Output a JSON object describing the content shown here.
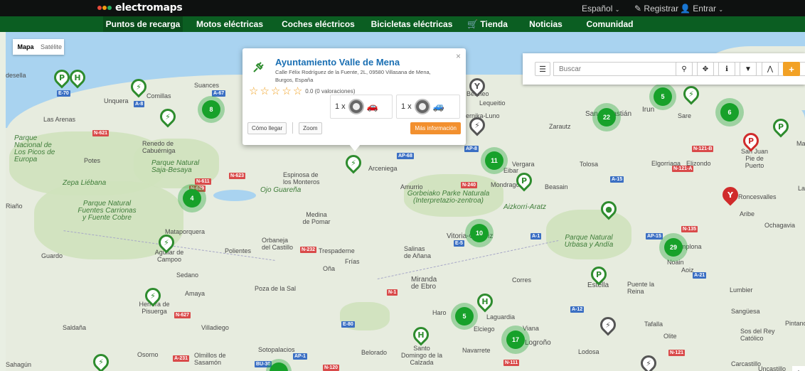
{
  "topbar": {
    "logo": "electromaps",
    "language": "Español",
    "register": "Registrar",
    "login": "Entrar"
  },
  "nav": [
    "Puntos de recarga",
    "Motos eléctricas",
    "Coches eléctricos",
    "Bicicletas eléctricas",
    "Tienda",
    "Noticias",
    "Comunidad"
  ],
  "maptype": {
    "map": "Mapa",
    "satellite": "Satélite"
  },
  "popup": {
    "title": "Ayuntamiento Valle de Mena",
    "address": "Calle Félix Rodríguez de la Fuente, 2L, 09580 Villasana de Mena, Burgos, España",
    "rating": "0.0 (0 valoraciones)",
    "connector1": "1 x",
    "connector2": "1 x",
    "directions": "Cómo llegar",
    "zoom": "Zoom",
    "more_info": "Más información",
    "close": "×"
  },
  "search": {
    "placeholder": "Buscar"
  },
  "clusters": [
    "8",
    "4",
    "11",
    "10",
    "5",
    "17",
    "22",
    "5",
    "6",
    "29"
  ],
  "places": [
    "desella",
    "Las Arenas",
    "Unquera",
    "Comillas",
    "Suances",
    "Parque Nacional de Los Picos de Europa",
    "Potes",
    "Renedo de Cabuérniga",
    "Parque Natural Saja-Besaya",
    "Zepa Liébana",
    "Espinosa de los Monteros",
    "Ojo Guareña",
    "Riaño",
    "Parque Natural Fuentes Carrionas y Fuente Cobre",
    "Medina de Pomar",
    "Mataporquera",
    "Orbaneja del Castillo",
    "Polientes",
    "Aguilar de Campoo",
    "Trespaderne",
    "Frías",
    "Oña",
    "Guardo",
    "Sedano",
    "Amaya",
    "Poza de la Sal",
    "Herrera de Pisuerga",
    "Villadiego",
    "Saldaña",
    "Osorno",
    "Olmillos de Sasamón",
    "Sotopalacios",
    "Belorado",
    "Santo Domingo de la Calzada",
    "Arceniega",
    "Amurrio",
    "Gorbeiako Parke Naturala (Interpretazio-zentroa)",
    "Salinas de Añana",
    "Miranda de Ebro",
    "Vitoria-Gasteiz",
    "Haro",
    "Laguardia",
    "Elciego",
    "Viana",
    "Navarrete",
    "Logroño",
    "Corres",
    "Parque Natural Urbasa y Andía",
    "Estella",
    "Puente la Reina",
    "Lodosa",
    "Tafalla",
    "Olite",
    "Sangüesa",
    "Carcastillo",
    "Uncastillo",
    "Lumbier",
    "Sos del Rey Católico",
    "Pamplona",
    "Noain",
    "Aoiz",
    "Aribe",
    "Ochagavia",
    "Elgorriaga",
    "Elizondo",
    "San Juan Pie de Puerto",
    "Roncesvalles",
    "Beasain",
    "Tolosa",
    "Zarautz",
    "San Sebastián",
    "Irun",
    "Sare",
    "Aizkorri-Aratz",
    "Eibar",
    "Vergara",
    "Mondragón",
    "Lequeitio",
    "Gernika-Luno",
    "Bermeo",
    "Pintano",
    "Sahagún",
    "Ma",
    "La"
  ],
  "roads": [
    "E-70",
    "A-8",
    "A-67",
    "N-621",
    "N-611",
    "N-623",
    "N-629",
    "N-627",
    "N-232",
    "N-240",
    "AP-68",
    "AP-8",
    "A-15",
    "A-1",
    "AP-15",
    "A-21",
    "N-121-A",
    "N-121-B",
    "N-135",
    "A-12",
    "E-80",
    "N-111",
    "A-231",
    "AP-1",
    "BU-30",
    "N-120",
    "N-1",
    "E-5",
    "N-121"
  ]
}
